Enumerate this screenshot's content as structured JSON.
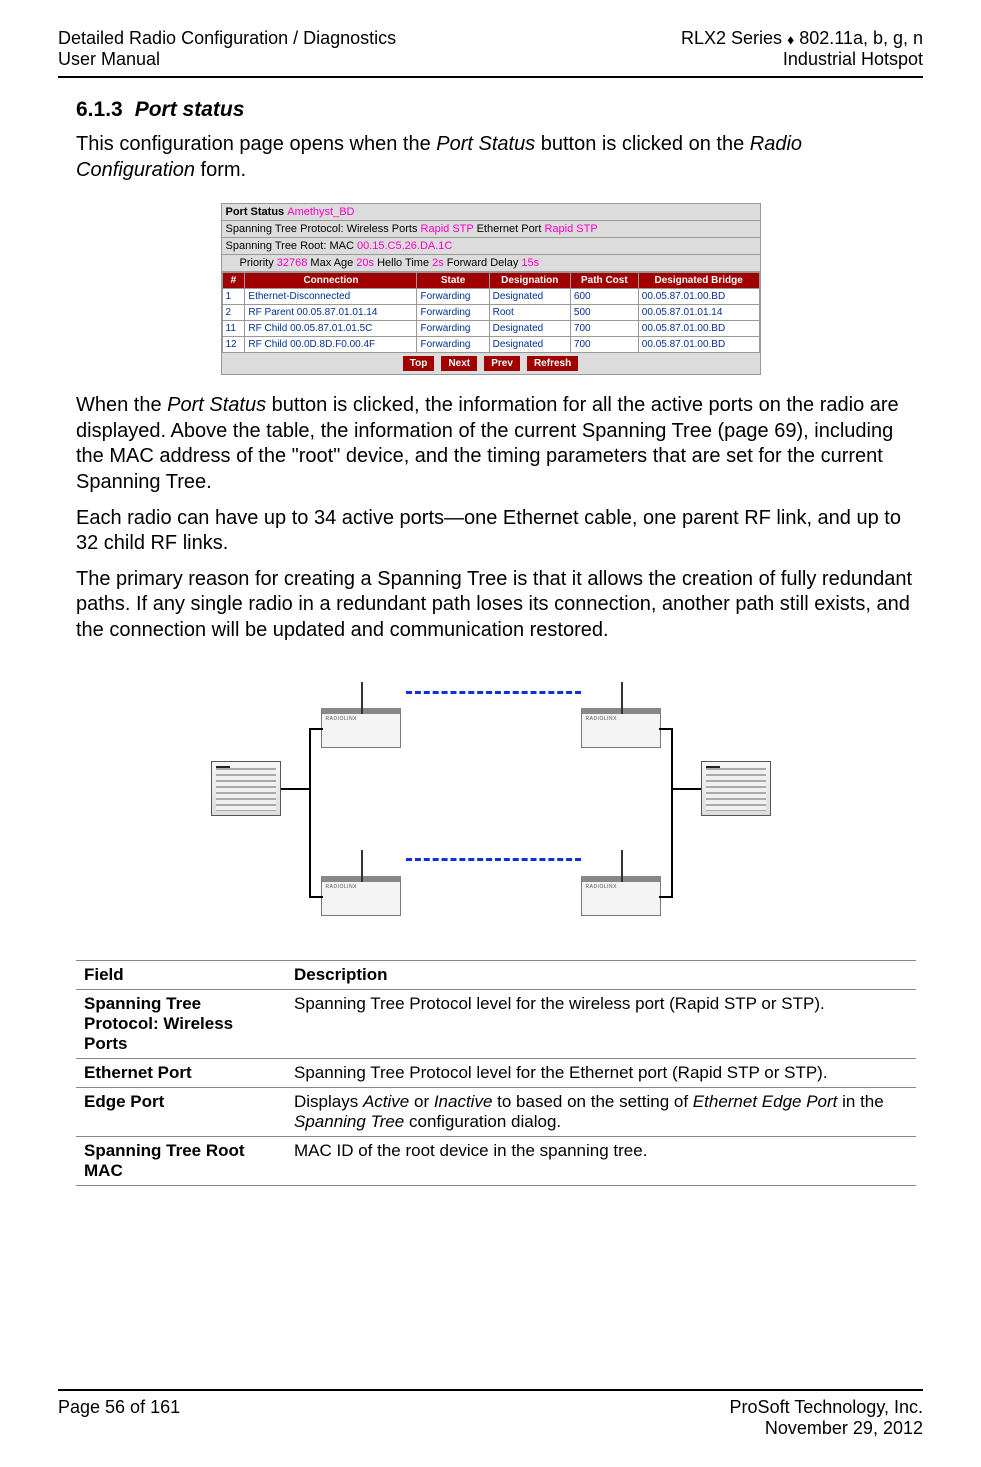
{
  "header": {
    "left1": "Detailed Radio Configuration / Diagnostics",
    "left2": "User Manual",
    "right1_a": "RLX2 Series ",
    "right1_b": " 802.11a, b, g, n",
    "right2": "Industrial Hotspot"
  },
  "section": {
    "number": "6.1.3",
    "title": "Port status"
  },
  "paragraphs": {
    "p1_a": "This configuration page opens when the ",
    "p1_b": "Port Status",
    "p1_c": " button is clicked on the ",
    "p1_d": "Radio Configuration",
    "p1_e": " form.",
    "p2_a": "When the ",
    "p2_b": "Port Status",
    "p2_c": " button is clicked, the information for all the active ports on the radio are displayed. Above the table, the information of the current Spanning Tree (page 69), including the MAC address of the \"root\" device, and the timing parameters that are set for the current Spanning Tree.",
    "p3": "Each radio can have up to 34 active ports—one Ethernet cable, one parent RF link, and up to 32 child RF links.",
    "p4": "The primary reason for creating a Spanning Tree is that it allows the creation of fully redundant paths. If any single radio in a redundant path loses its connection, another path still exists, and the connection will be updated and communication restored."
  },
  "port_status_fig": {
    "title_label": "Port Status",
    "radio_name": "Amethyst_BD",
    "proto_line1_a": "Spanning Tree Protocol: Wireless Ports ",
    "proto_line1_b": "Rapid STP",
    "proto_line1_c": " Ethernet Port ",
    "proto_line1_d": "Rapid STP",
    "proto_line2_a": "Spanning Tree Root: MAC ",
    "proto_line2_b": "00.15.C5.26.DA.1C",
    "proto_line3_a": "Priority ",
    "proto_line3_b": "32768",
    "proto_line3_c": " Max Age ",
    "proto_line3_d": "20s",
    "proto_line3_e": " Hello Time ",
    "proto_line3_f": "2s",
    "proto_line3_g": " Forward Delay ",
    "proto_line3_h": "15s",
    "headers": [
      "#",
      "Connection",
      "State",
      "Designation",
      "Path Cost",
      "Designated Bridge"
    ],
    "rows": [
      {
        "num": "1",
        "conn": "Ethernet-Disconnected",
        "state": "Forwarding",
        "desig": "Designated",
        "cost": "600",
        "bridge": "00.05.87.01.00.BD"
      },
      {
        "num": "2",
        "conn": "RF Parent 00.05.87.01.01.14",
        "state": "Forwarding",
        "desig": "Root",
        "cost": "500",
        "bridge": "00.05.87.01.01.14"
      },
      {
        "num": "11",
        "conn": "RF Child 00.05.87.01.01.5C",
        "state": "Forwarding",
        "desig": "Designated",
        "cost": "700",
        "bridge": "00.05.87.01.00.BD"
      },
      {
        "num": "12",
        "conn": "RF Child 00.0D.8D.F0.00.4F",
        "state": "Forwarding",
        "desig": "Designated",
        "cost": "700",
        "bridge": "00.05.87.01.00.BD"
      }
    ],
    "buttons": [
      "Top",
      "Next",
      "Prev",
      "Refresh"
    ]
  },
  "fd_table": {
    "head_field": "Field",
    "head_desc": "Description",
    "rows": [
      {
        "field": "Spanning Tree Protocol: Wireless Ports",
        "desc_plain": "Spanning Tree Protocol level for the wireless port (Rapid STP or STP)."
      },
      {
        "field": "Ethernet Port",
        "desc_plain": "Spanning Tree Protocol level for the Ethernet port (Rapid STP or STP)."
      },
      {
        "field": "Edge Port",
        "desc_html": true,
        "desc_a": "Displays ",
        "desc_b": "Active",
        "desc_c": " or ",
        "desc_d": "Inactive",
        "desc_e": " to based on the setting of ",
        "desc_f": "Ethernet Edge Port",
        "desc_g": " in the ",
        "desc_h": "Spanning Tree",
        "desc_i": " configuration dialog."
      },
      {
        "field": "Spanning Tree Root MAC",
        "desc_plain": "MAC ID of the root device in the spanning tree."
      }
    ]
  },
  "footer": {
    "left": "Page 56 of 161",
    "right1": "ProSoft Technology, Inc.",
    "right2": "November 29, 2012"
  }
}
